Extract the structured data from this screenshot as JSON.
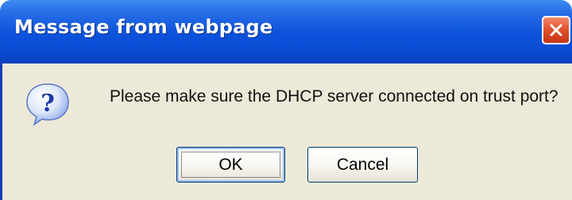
{
  "dialog": {
    "title": "Message from webpage",
    "message": "Please make sure the DHCP server connected on trust port?",
    "icon": "question-icon",
    "buttons": {
      "ok_label": "OK",
      "cancel_label": "Cancel"
    }
  },
  "colors": {
    "titlebar": "#0a4ad2",
    "close": "#e2522d",
    "body": "#ece9d8"
  }
}
